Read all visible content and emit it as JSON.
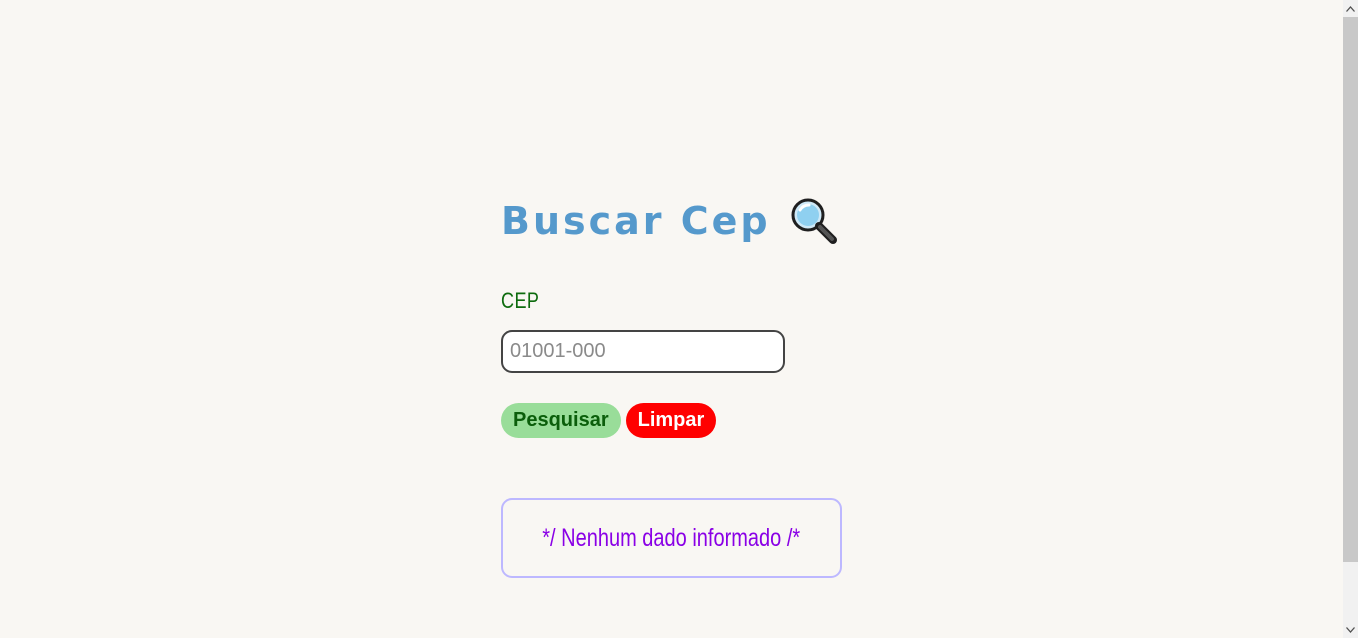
{
  "header": {
    "title": "Buscar Cep",
    "title_icon": "magnifying-glass-icon"
  },
  "form": {
    "cep_label": "CEP",
    "cep_placeholder": "01001-000",
    "cep_value": ""
  },
  "actions": {
    "search_label": "Pesquisar",
    "clear_label": "Limpar"
  },
  "result": {
    "message": "*/ Nenhum dado informado /*"
  },
  "colors": {
    "background": "#f9f7f3",
    "title": "#5599cc",
    "label": "#0d6b0d",
    "search_button": "#99dd99",
    "clear_button": "#ff0000",
    "result_border": "#bdb8ff",
    "result_text": "#8a00e6"
  }
}
